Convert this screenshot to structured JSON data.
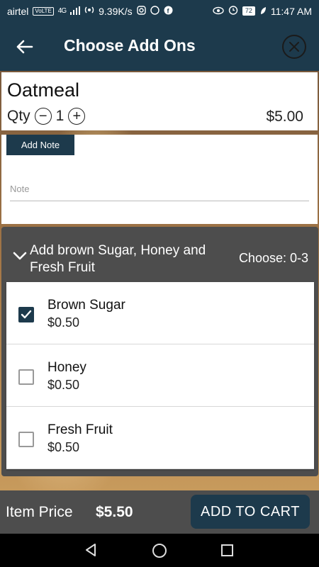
{
  "status_bar": {
    "carrier": "airtel",
    "volte": "VoLTE",
    "network": "4G",
    "speed": "9.39K/s",
    "battery": "72",
    "time": "11:47 AM"
  },
  "header": {
    "title": "Choose Add Ons"
  },
  "product": {
    "name": "Oatmeal",
    "qty_label": "Qty",
    "qty_value": "1",
    "minus": "−",
    "plus": "+",
    "price": "$5.00"
  },
  "note": {
    "add_note_label": "Add Note",
    "placeholder": "Note"
  },
  "addon_group": {
    "title": "Add brown Sugar, Honey and Fresh Fruit",
    "choose": "Choose: 0-3",
    "options": [
      {
        "name": "Brown Sugar",
        "price": "$0.50",
        "checked": true
      },
      {
        "name": "Honey",
        "price": "$0.50",
        "checked": false
      },
      {
        "name": "Fresh Fruit",
        "price": "$0.50",
        "checked": false
      }
    ]
  },
  "footer": {
    "item_price_label": "Item Price",
    "item_price_value": "$5.50",
    "add_to_cart": "ADD TO CART"
  },
  "colors": {
    "primary": "#1d3a4c",
    "panel": "#4d4d4d"
  }
}
